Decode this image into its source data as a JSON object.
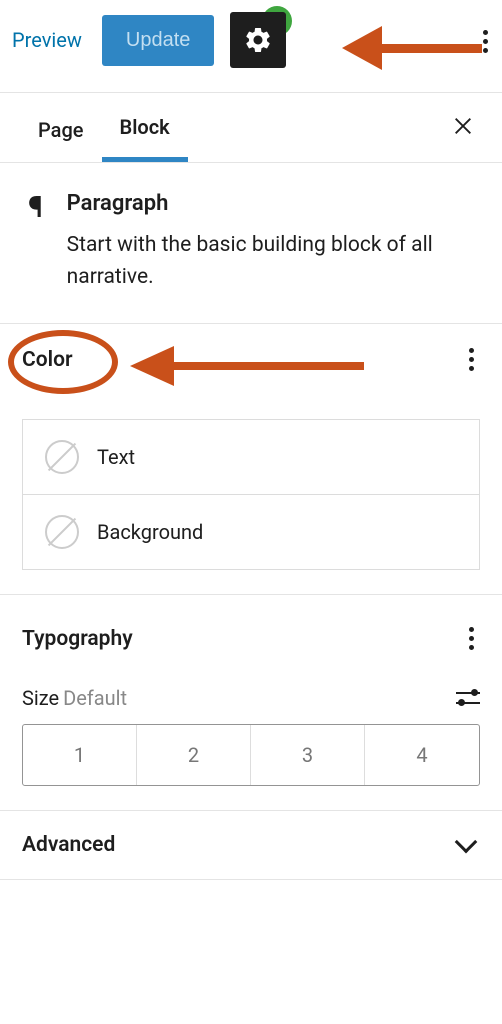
{
  "topbar": {
    "preview": "Preview",
    "update": "Update"
  },
  "tabs": {
    "page": "Page",
    "block": "Block"
  },
  "block": {
    "title": "Paragraph",
    "description": "Start with the basic building block of all narrative."
  },
  "color": {
    "title": "Color",
    "text": "Text",
    "background": "Background"
  },
  "typography": {
    "title": "Typography",
    "sizeLabel": "Size",
    "sizeDefault": "Default",
    "sizes": [
      "1",
      "2",
      "3",
      "4"
    ]
  },
  "advanced": {
    "title": "Advanced"
  }
}
